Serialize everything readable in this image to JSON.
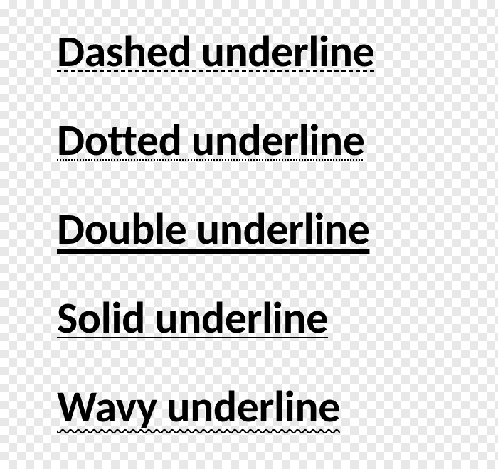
{
  "samples": [
    {
      "label": "Dashed underline",
      "style": "dashed"
    },
    {
      "label": "Dotted underline",
      "style": "dotted"
    },
    {
      "label": "Double underline",
      "style": "double"
    },
    {
      "label": "Solid underline",
      "style": "solid"
    },
    {
      "label": "Wavy underline",
      "style": "wavy"
    }
  ]
}
